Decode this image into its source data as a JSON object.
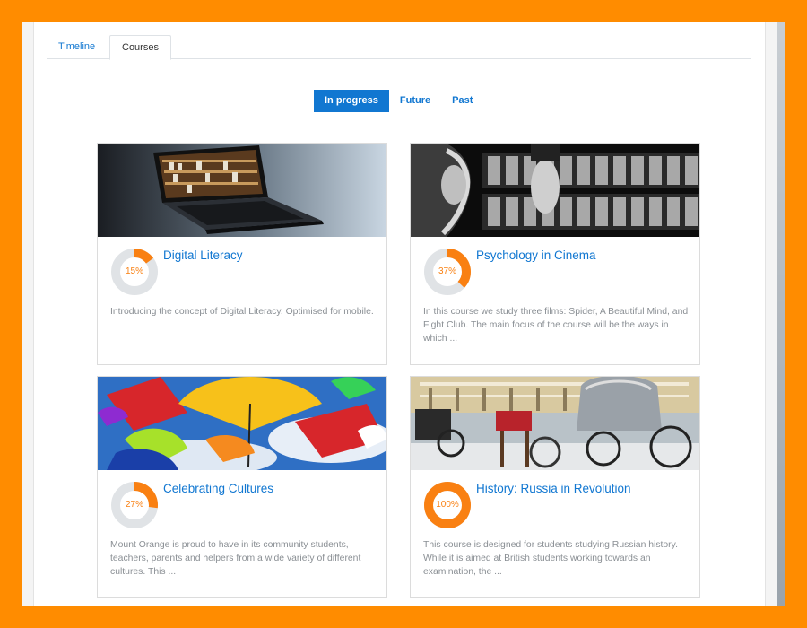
{
  "tabs": [
    {
      "label": "Timeline",
      "active": false
    },
    {
      "label": "Courses",
      "active": true
    }
  ],
  "filters": [
    {
      "label": "In progress",
      "active": true
    },
    {
      "label": "Future",
      "active": false
    },
    {
      "label": "Past",
      "active": false
    }
  ],
  "courses": [
    {
      "title": "Digital Literacy",
      "progress": 15,
      "progress_label": "15%",
      "description": "Introducing the concept of Digital Literacy. Optimised for mobile.",
      "image": "laptop-image"
    },
    {
      "title": "Psychology in Cinema",
      "progress": 37,
      "progress_label": "37%",
      "description": "In this course we study three films: Spider, A Beautiful Mind, and Fight Club. The main focus of the course will be the ways in which ...",
      "image": "film-strip-image"
    },
    {
      "title": "Celebrating Cultures",
      "progress": 27,
      "progress_label": "27%",
      "description": "Mount Orange is proud to have in its community students, teachers, parents and helpers from a wide variety of different cultures. This ...",
      "image": "umbrellas-image"
    },
    {
      "title": "History: Russia in Revolution",
      "progress": 100,
      "progress_label": "100%",
      "description": "This course is designed for students studying Russian history. While it is aimed at British students working towards an examination, the ...",
      "image": "horse-carriage-image"
    }
  ],
  "colors": {
    "accent": "#1177d1",
    "progress": "#f98012",
    "track": "#e0e3e6",
    "frame": "#ff8c00"
  }
}
